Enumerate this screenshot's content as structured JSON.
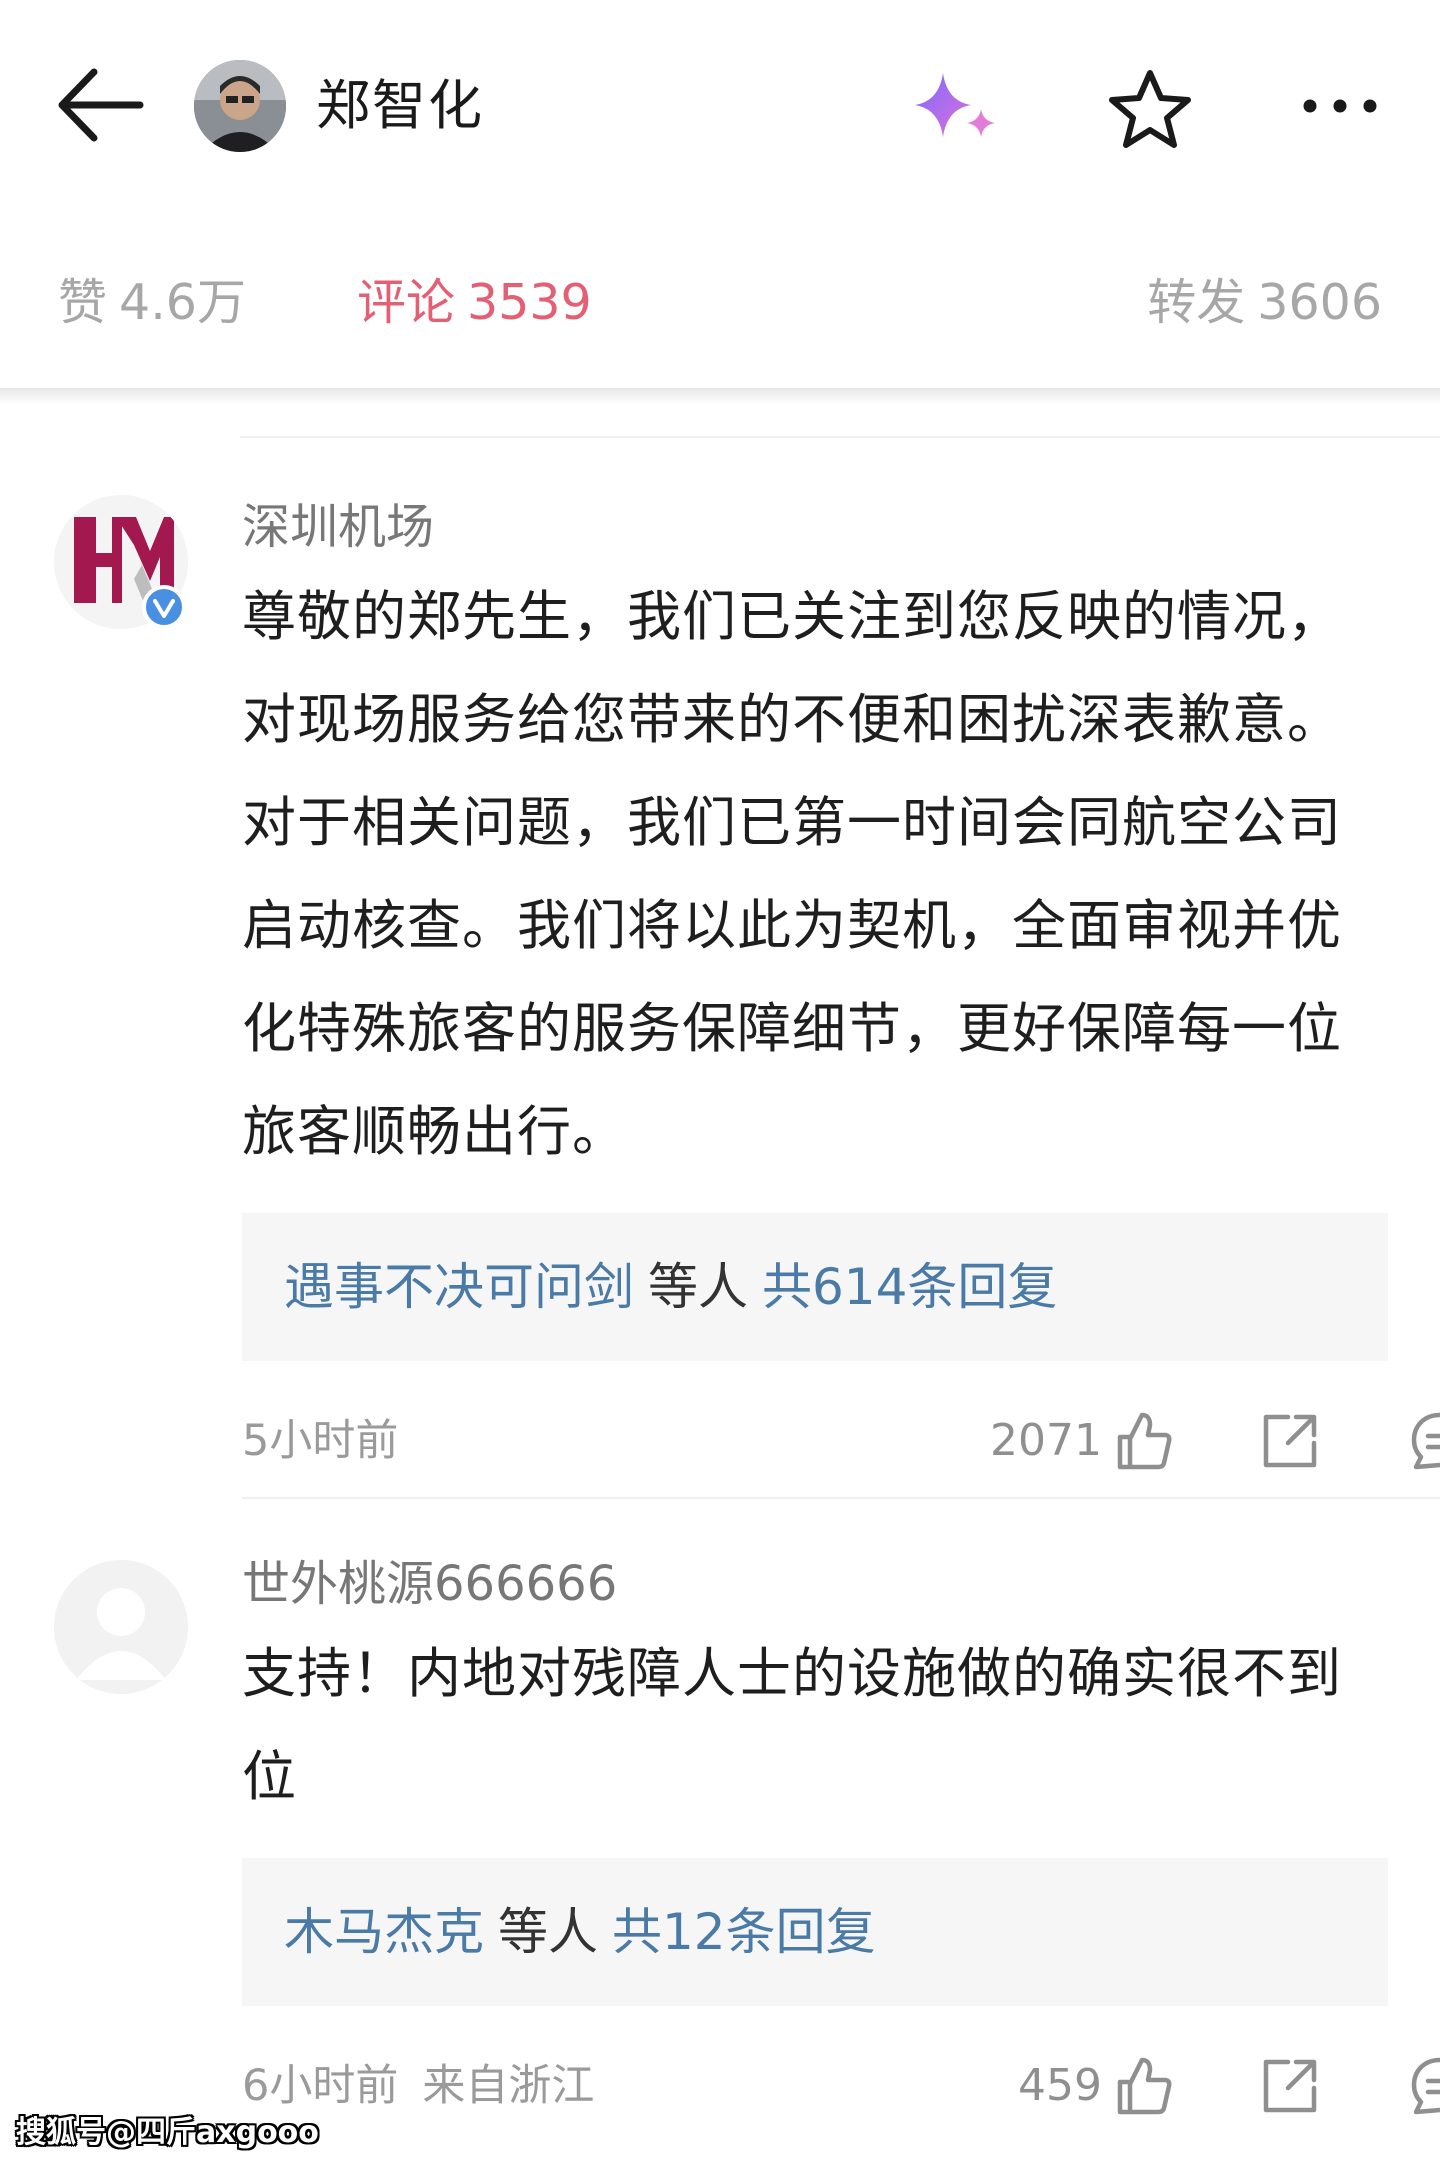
{
  "header": {
    "name": "郑智化",
    "icons": [
      "back-arrow-icon",
      "user-avatar",
      "ai-sparkle-icon",
      "star-icon",
      "more-icon"
    ]
  },
  "stats": {
    "likes_label": "赞",
    "likes_count": "4.6万",
    "comments_label": "评论",
    "comments_count": "3539",
    "reposts_label": "转发",
    "reposts_count": "3606",
    "active_color": "#e36074",
    "inactive_color": "#a7a7a7"
  },
  "comments": [
    {
      "author": "深圳机场",
      "verified": true,
      "text": "尊敬的郑先生，我们已关注到您反映的情况，对现场服务给您带来的不便和困扰深表歉意。对于相关问题，我们已第一时间会同航空公司启动核查。我们将以此为契机，全面审视并优化特殊旅客的服务保障细节，更好保障每一位旅客顺畅出行。",
      "replies_user": "遇事不决可问剑",
      "replies_mid": "等人",
      "replies_count": "共614条回复",
      "time": "5小时前",
      "location": "",
      "likes": "2071"
    },
    {
      "author": "世外桃源666666",
      "verified": false,
      "text": "支持！内地对残障人士的设施做的确实很不到位",
      "replies_user": "木马杰克",
      "replies_mid": "等人",
      "replies_count": "共12条回复",
      "time": "6小时前",
      "location": "来自浙江",
      "likes": "459"
    }
  ],
  "watermark": "搜狐号@四斤axgooo",
  "colors": {
    "link_blue": "#4a7aa6",
    "airport_logo": "#a3184f"
  }
}
